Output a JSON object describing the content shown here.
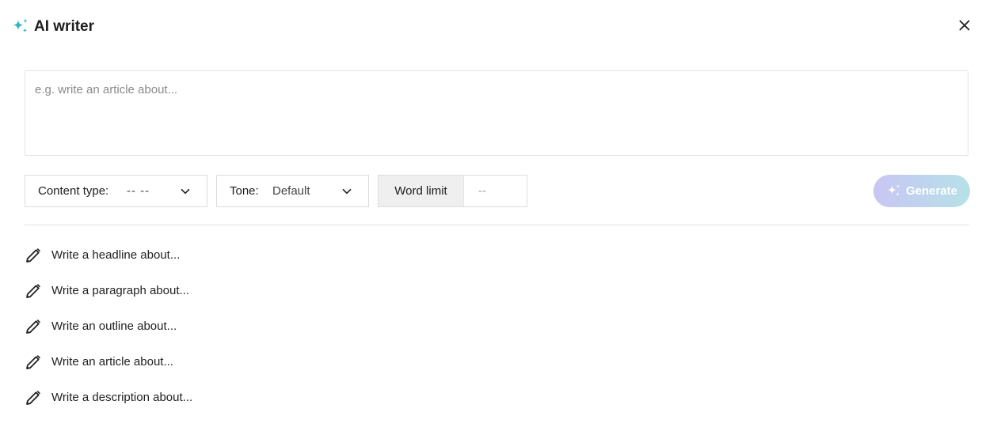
{
  "dialog": {
    "title": "AI writer",
    "title_icon": "sparkle-icon",
    "close_icon": "close-icon",
    "accent_color": "#2eb6c6"
  },
  "prompt": {
    "placeholder": "e.g. write an article about...",
    "value": ""
  },
  "controls": {
    "content_type": {
      "label": "Content type:",
      "value": "-- --"
    },
    "tone": {
      "label": "Tone:",
      "value": "Default"
    },
    "word_limit": {
      "label": "Word limit",
      "placeholder": "--"
    },
    "generate": {
      "label": "Generate",
      "icon": "sparkle-icon",
      "gradient": [
        "#c9c6f3",
        "#b6e1e8"
      ]
    }
  },
  "suggestions": [
    {
      "icon": "pencil-icon",
      "label": "Write a headline about..."
    },
    {
      "icon": "pencil-icon",
      "label": "Write a paragraph about..."
    },
    {
      "icon": "pencil-icon",
      "label": "Write an outline about..."
    },
    {
      "icon": "pencil-icon",
      "label": "Write an article about..."
    },
    {
      "icon": "pencil-icon",
      "label": "Write a description about..."
    }
  ]
}
